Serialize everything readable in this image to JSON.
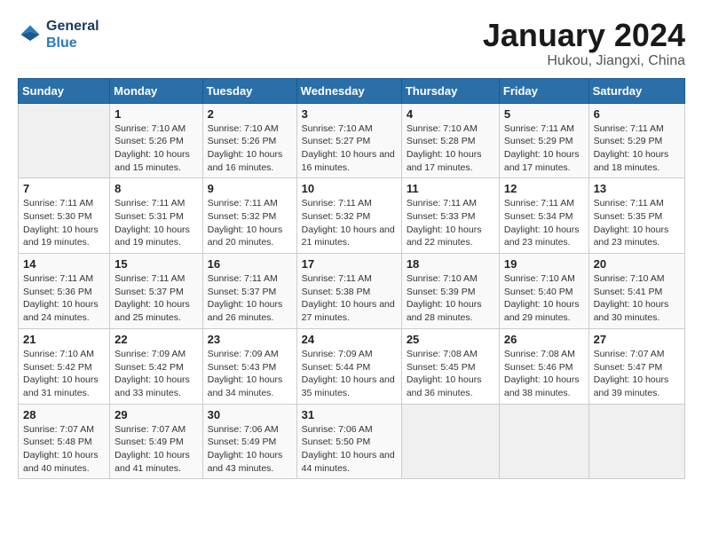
{
  "header": {
    "logo_line1": "General",
    "logo_line2": "Blue",
    "month_title": "January 2024",
    "subtitle": "Hukou, Jiangxi, China"
  },
  "weekdays": [
    "Sunday",
    "Monday",
    "Tuesday",
    "Wednesday",
    "Thursday",
    "Friday",
    "Saturday"
  ],
  "weeks": [
    [
      {
        "day": "",
        "empty": true
      },
      {
        "day": "1",
        "sunrise": "7:10 AM",
        "sunset": "5:26 PM",
        "daylight": "10 hours and 15 minutes."
      },
      {
        "day": "2",
        "sunrise": "7:10 AM",
        "sunset": "5:26 PM",
        "daylight": "10 hours and 16 minutes."
      },
      {
        "day": "3",
        "sunrise": "7:10 AM",
        "sunset": "5:27 PM",
        "daylight": "10 hours and 16 minutes."
      },
      {
        "day": "4",
        "sunrise": "7:10 AM",
        "sunset": "5:28 PM",
        "daylight": "10 hours and 17 minutes."
      },
      {
        "day": "5",
        "sunrise": "7:11 AM",
        "sunset": "5:29 PM",
        "daylight": "10 hours and 17 minutes."
      },
      {
        "day": "6",
        "sunrise": "7:11 AM",
        "sunset": "5:29 PM",
        "daylight": "10 hours and 18 minutes."
      }
    ],
    [
      {
        "day": "7",
        "sunrise": "7:11 AM",
        "sunset": "5:30 PM",
        "daylight": "10 hours and 19 minutes."
      },
      {
        "day": "8",
        "sunrise": "7:11 AM",
        "sunset": "5:31 PM",
        "daylight": "10 hours and 19 minutes."
      },
      {
        "day": "9",
        "sunrise": "7:11 AM",
        "sunset": "5:32 PM",
        "daylight": "10 hours and 20 minutes."
      },
      {
        "day": "10",
        "sunrise": "7:11 AM",
        "sunset": "5:32 PM",
        "daylight": "10 hours and 21 minutes."
      },
      {
        "day": "11",
        "sunrise": "7:11 AM",
        "sunset": "5:33 PM",
        "daylight": "10 hours and 22 minutes."
      },
      {
        "day": "12",
        "sunrise": "7:11 AM",
        "sunset": "5:34 PM",
        "daylight": "10 hours and 23 minutes."
      },
      {
        "day": "13",
        "sunrise": "7:11 AM",
        "sunset": "5:35 PM",
        "daylight": "10 hours and 23 minutes."
      }
    ],
    [
      {
        "day": "14",
        "sunrise": "7:11 AM",
        "sunset": "5:36 PM",
        "daylight": "10 hours and 24 minutes."
      },
      {
        "day": "15",
        "sunrise": "7:11 AM",
        "sunset": "5:37 PM",
        "daylight": "10 hours and 25 minutes."
      },
      {
        "day": "16",
        "sunrise": "7:11 AM",
        "sunset": "5:37 PM",
        "daylight": "10 hours and 26 minutes."
      },
      {
        "day": "17",
        "sunrise": "7:11 AM",
        "sunset": "5:38 PM",
        "daylight": "10 hours and 27 minutes."
      },
      {
        "day": "18",
        "sunrise": "7:10 AM",
        "sunset": "5:39 PM",
        "daylight": "10 hours and 28 minutes."
      },
      {
        "day": "19",
        "sunrise": "7:10 AM",
        "sunset": "5:40 PM",
        "daylight": "10 hours and 29 minutes."
      },
      {
        "day": "20",
        "sunrise": "7:10 AM",
        "sunset": "5:41 PM",
        "daylight": "10 hours and 30 minutes."
      }
    ],
    [
      {
        "day": "21",
        "sunrise": "7:10 AM",
        "sunset": "5:42 PM",
        "daylight": "10 hours and 31 minutes."
      },
      {
        "day": "22",
        "sunrise": "7:09 AM",
        "sunset": "5:42 PM",
        "daylight": "10 hours and 33 minutes."
      },
      {
        "day": "23",
        "sunrise": "7:09 AM",
        "sunset": "5:43 PM",
        "daylight": "10 hours and 34 minutes."
      },
      {
        "day": "24",
        "sunrise": "7:09 AM",
        "sunset": "5:44 PM",
        "daylight": "10 hours and 35 minutes."
      },
      {
        "day": "25",
        "sunrise": "7:08 AM",
        "sunset": "5:45 PM",
        "daylight": "10 hours and 36 minutes."
      },
      {
        "day": "26",
        "sunrise": "7:08 AM",
        "sunset": "5:46 PM",
        "daylight": "10 hours and 38 minutes."
      },
      {
        "day": "27",
        "sunrise": "7:07 AM",
        "sunset": "5:47 PM",
        "daylight": "10 hours and 39 minutes."
      }
    ],
    [
      {
        "day": "28",
        "sunrise": "7:07 AM",
        "sunset": "5:48 PM",
        "daylight": "10 hours and 40 minutes."
      },
      {
        "day": "29",
        "sunrise": "7:07 AM",
        "sunset": "5:49 PM",
        "daylight": "10 hours and 41 minutes."
      },
      {
        "day": "30",
        "sunrise": "7:06 AM",
        "sunset": "5:49 PM",
        "daylight": "10 hours and 43 minutes."
      },
      {
        "day": "31",
        "sunrise": "7:06 AM",
        "sunset": "5:50 PM",
        "daylight": "10 hours and 44 minutes."
      },
      {
        "day": "",
        "empty": true
      },
      {
        "day": "",
        "empty": true
      },
      {
        "day": "",
        "empty": true
      }
    ]
  ]
}
